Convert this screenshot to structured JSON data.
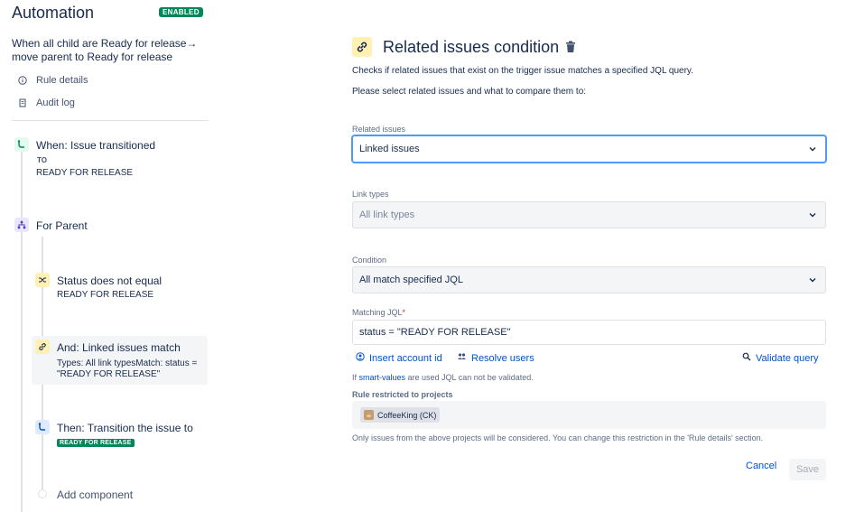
{
  "sidebar": {
    "title": "Automation",
    "badge": "ENABLED",
    "rule_name": "When all child are Ready for release→ move parent to Ready for release",
    "links": [
      {
        "label": "Rule details",
        "icon": "info-icon"
      },
      {
        "label": "Audit log",
        "icon": "document-icon"
      }
    ],
    "trigger": {
      "title": "When: Issue transitioned",
      "to_label": "TO",
      "status": "READY FOR RELEASE",
      "icon": "transition-icon"
    },
    "branch": {
      "title": "For Parent",
      "icon": "branch-icon"
    },
    "condition": {
      "title": "Status does not equal",
      "status": "READY FOR RELEASE",
      "icon": "shuffle-icon"
    },
    "selected": {
      "title": "And: Linked issues match",
      "detail": "Types: All link typesMatch: status = \"READY FOR RELEASE\"",
      "icon": "link-icon"
    },
    "action": {
      "title": "Then: Transition the issue to",
      "status": "READY FOR RELEASE",
      "icon": "transition-icon"
    },
    "add_component": "Add component"
  },
  "main": {
    "title": "Related issues condition",
    "description": "Checks if related issues that exist on the trigger issue matches a specified JQL query.",
    "instruction": "Please select related issues and what to compare them to:",
    "related_issues": {
      "label": "Related issues",
      "value": "Linked issues"
    },
    "link_types": {
      "label": "Link types",
      "placeholder": "All link types"
    },
    "condition": {
      "label": "Condition",
      "value": "All match specified JQL"
    },
    "matching_jql": {
      "label": "Matching JQL",
      "required": "*",
      "value": "status = \"READY FOR RELEASE\""
    },
    "insert_account": "Insert account id",
    "resolve_users": "Resolve users",
    "validate_query": "Validate query",
    "hint_prefix": "If ",
    "hint_link": "smart-values",
    "hint_suffix": " are used JQL can not be validated.",
    "restricted_label": "Rule restricted to projects",
    "project": "CoffeeKing (CK)",
    "restriction_note": "Only issues from the above projects will be considered. You can change this restriction in the 'Rule details' section.",
    "cancel": "Cancel",
    "save": "Save"
  },
  "colors": {
    "accent": "#0052cc",
    "success": "#00875a",
    "focus": "#4c9aff"
  }
}
